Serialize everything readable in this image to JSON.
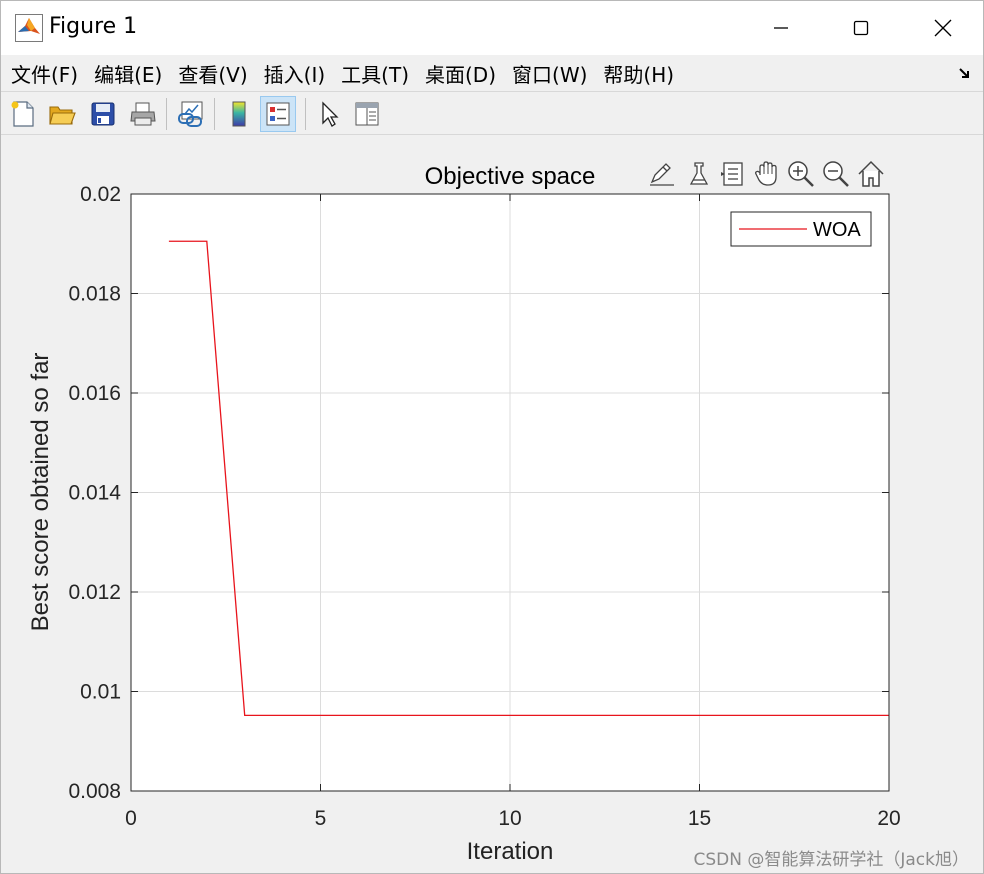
{
  "window": {
    "title": "Figure 1"
  },
  "menu": {
    "items": [
      "文件(F)",
      "编辑(E)",
      "查看(V)",
      "插入(I)",
      "工具(T)",
      "桌面(D)",
      "窗口(W)",
      "帮助(H)"
    ]
  },
  "toolbar": {
    "icons": [
      "new-figure-icon",
      "open-icon",
      "save-icon",
      "print-icon",
      "link-icon",
      "colorbar-icon",
      "legend-icon",
      "pointer-icon",
      "property-editor-icon"
    ]
  },
  "axes_toolbar": {
    "icons": [
      "edit-brush-icon",
      "data-cursor-icon",
      "data-tips-icon",
      "pan-icon",
      "zoom-in-icon",
      "zoom-out-icon",
      "home-icon"
    ]
  },
  "chart_data": {
    "type": "line",
    "title": "Objective space",
    "xlabel": "Iteration",
    "ylabel": "Best score obtained so far",
    "xlim": [
      0,
      20
    ],
    "ylim": [
      0.008,
      0.02
    ],
    "xticks": [
      0,
      5,
      10,
      15,
      20
    ],
    "xtick_labels": [
      "0",
      "5",
      "10",
      "15",
      "20"
    ],
    "yticks": [
      0.008,
      0.01,
      0.012,
      0.014,
      0.016,
      0.018,
      0.02
    ],
    "ytick_labels": [
      "0.008",
      "0.01",
      "0.012",
      "0.014",
      "0.016",
      "0.018",
      "0.02"
    ],
    "grid": true,
    "legend_placement": "top-right",
    "series": [
      {
        "name": "WOA",
        "color": "#e8141c",
        "x": [
          1,
          2,
          3,
          4,
          5,
          6,
          7,
          8,
          9,
          10,
          11,
          12,
          13,
          14,
          15,
          16,
          17,
          18,
          19,
          20
        ],
        "y": [
          0.01905,
          0.01905,
          0.00952,
          0.00952,
          0.00952,
          0.00952,
          0.00952,
          0.00952,
          0.00952,
          0.00952,
          0.00952,
          0.00952,
          0.00952,
          0.00952,
          0.00952,
          0.00952,
          0.00952,
          0.00952,
          0.00952,
          0.00952
        ]
      }
    ]
  },
  "watermark": "CSDN @智能算法研学社（Jack旭）"
}
